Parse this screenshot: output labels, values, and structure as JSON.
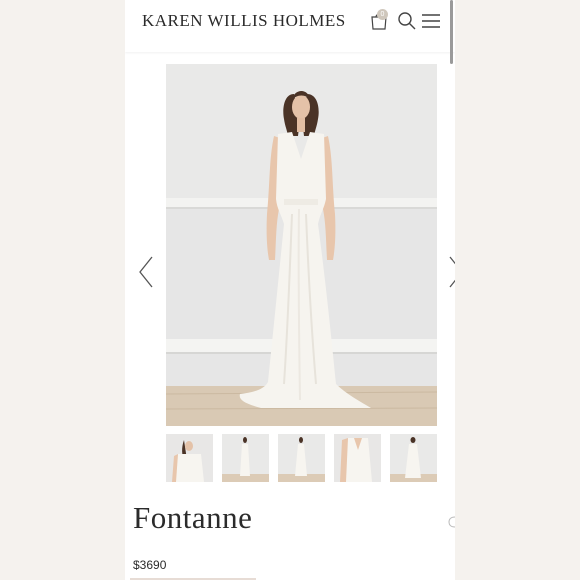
{
  "brand": "KAREN WILLIS HOLMES",
  "cart": {
    "count": "0"
  },
  "product": {
    "name": "Fontanne",
    "price": "$3690"
  },
  "thumbnails": [
    {
      "view": "close-up"
    },
    {
      "view": "full-front"
    },
    {
      "view": "full-front"
    },
    {
      "view": "detail"
    },
    {
      "view": "back"
    }
  ],
  "colors": {
    "page_bg": "#f5f2ee",
    "panel_bg": "#ffffff",
    "gown": "#f7f5f0"
  }
}
